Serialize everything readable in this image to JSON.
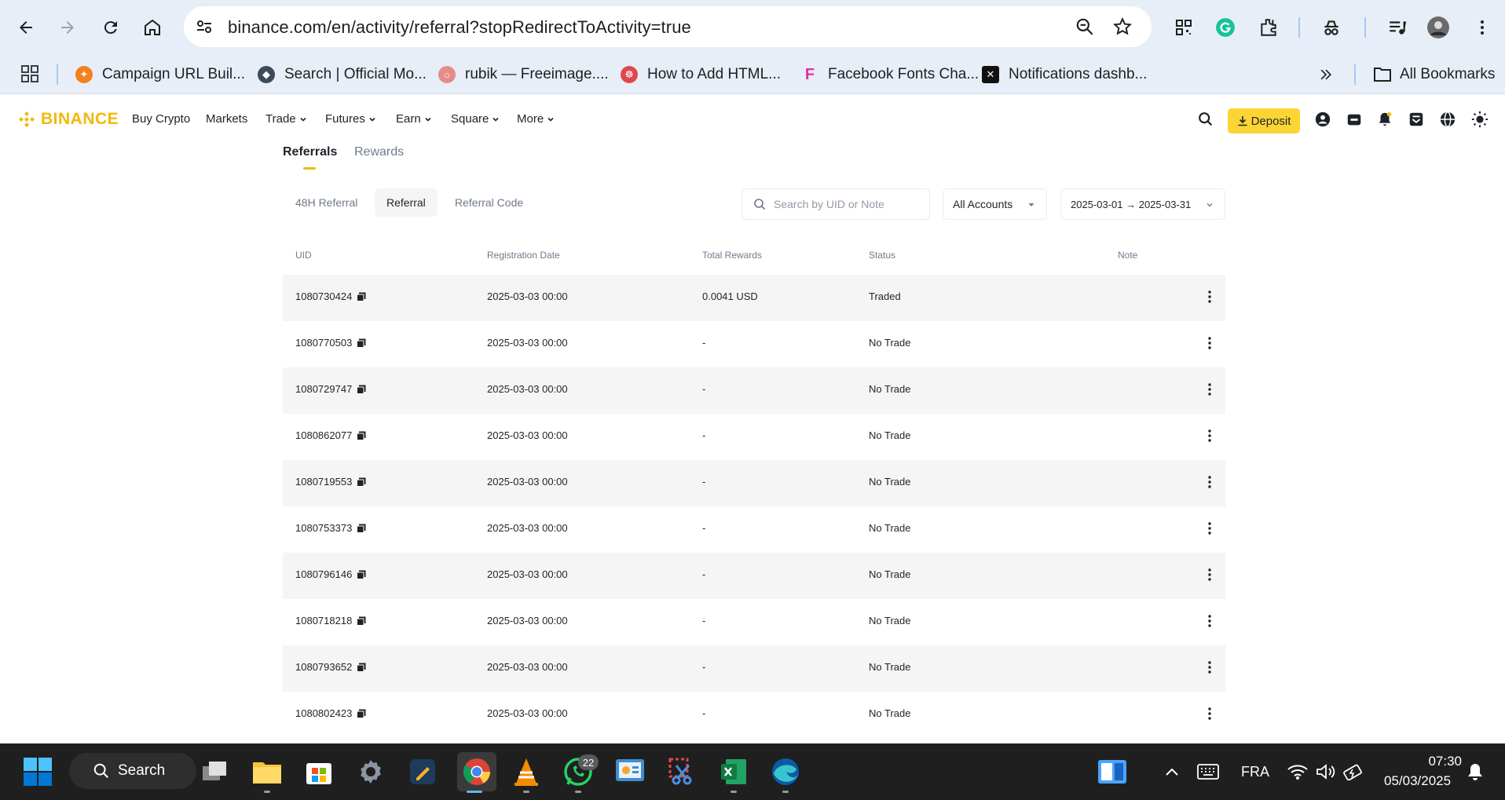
{
  "browser": {
    "url": "binance.com/en/activity/referral?stopRedirectToActivity=true",
    "bookmarks": [
      {
        "label": "Campaign URL Buil...",
        "icon": "campaign-url-builder-icon",
        "color": "#f4801f"
      },
      {
        "label": "Search | Official Mo...",
        "icon": "compass-icon",
        "color": "#3c4a5c"
      },
      {
        "label": "rubik — Freeimage....",
        "icon": "freeimage-icon",
        "color": "#e58b8b"
      },
      {
        "label": "How to Add HTML...",
        "icon": "html-guide-icon",
        "color": "#e0474c"
      },
      {
        "label": "Facebook Fonts Cha...",
        "icon": "facebook-fonts-icon",
        "color": "#e0309c"
      },
      {
        "label": "Notifications dashb...",
        "icon": "x-logo-icon",
        "color": "#111111"
      }
    ],
    "all_bookmarks": "All Bookmarks"
  },
  "header": {
    "logo": "BINANCE",
    "menu": [
      {
        "label": "Buy Crypto",
        "dropdown": false
      },
      {
        "label": "Markets",
        "dropdown": false
      },
      {
        "label": "Trade",
        "dropdown": true
      },
      {
        "label": "Futures",
        "dropdown": true
      },
      {
        "label": "Earn",
        "dropdown": true
      },
      {
        "label": "Square",
        "dropdown": true
      },
      {
        "label": "More",
        "dropdown": true
      }
    ],
    "deposit_label": "Deposit"
  },
  "tabs": {
    "main": [
      "Referrals",
      "Rewards"
    ],
    "sub": [
      "48H Referral",
      "Referral",
      "Referral Code"
    ]
  },
  "filters": {
    "search_placeholder": "Search by UID or Note",
    "accounts": "All Accounts",
    "date_range": "2025-03-01 → 2025-03-31"
  },
  "table": {
    "columns": [
      "UID",
      "Registration Date",
      "Total Rewards",
      "Status",
      "Note"
    ],
    "rows": [
      {
        "uid": "1080730424",
        "date": "2025-03-03 00:00",
        "rewards": "0.0041 USD",
        "status": "Traded",
        "note": ""
      },
      {
        "uid": "1080770503",
        "date": "2025-03-03 00:00",
        "rewards": "-",
        "status": "No Trade",
        "note": ""
      },
      {
        "uid": "1080729747",
        "date": "2025-03-03 00:00",
        "rewards": "-",
        "status": "No Trade",
        "note": ""
      },
      {
        "uid": "1080862077",
        "date": "2025-03-03 00:00",
        "rewards": "-",
        "status": "No Trade",
        "note": ""
      },
      {
        "uid": "1080719553",
        "date": "2025-03-03 00:00",
        "rewards": "-",
        "status": "No Trade",
        "note": ""
      },
      {
        "uid": "1080753373",
        "date": "2025-03-03 00:00",
        "rewards": "-",
        "status": "No Trade",
        "note": ""
      },
      {
        "uid": "1080796146",
        "date": "2025-03-03 00:00",
        "rewards": "-",
        "status": "No Trade",
        "note": ""
      },
      {
        "uid": "1080718218",
        "date": "2025-03-03 00:00",
        "rewards": "-",
        "status": "No Trade",
        "note": ""
      },
      {
        "uid": "1080793652",
        "date": "2025-03-03 00:00",
        "rewards": "-",
        "status": "No Trade",
        "note": ""
      },
      {
        "uid": "1080802423",
        "date": "2025-03-03 00:00",
        "rewards": "-",
        "status": "No Trade",
        "note": ""
      }
    ]
  },
  "taskbar": {
    "search_label": "Search",
    "whatsapp_badge": "22",
    "language": "FRA",
    "time": "07:30",
    "date": "05/03/2025"
  },
  "colors": {
    "brand": "#f0b90b",
    "deposit": "#fcd535",
    "row_alt": "#f5f5f5"
  }
}
